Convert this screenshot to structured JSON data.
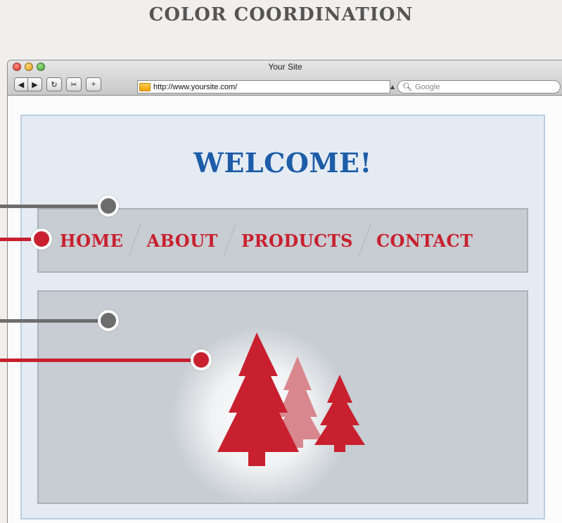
{
  "infographic": {
    "title": "COLOR COORDINATION"
  },
  "browser": {
    "window_title": "Your Site",
    "url": "http://www.yoursite.com/",
    "search_placeholder": "Google",
    "buttons": {
      "back": "◀",
      "forward": "▶",
      "reload": "↻",
      "snapback": "✂",
      "add_bookmark": "+"
    }
  },
  "site": {
    "heading": "WELCOME!",
    "nav": [
      "HOME",
      "ABOUT",
      "PRODUCTS",
      "CONTACT"
    ]
  },
  "colors": {
    "heading_blue": "#1d5ca8",
    "accent_red": "#c8202f",
    "callout_gray": "#6d6d6d",
    "panel_gray": "#c7cdd2",
    "page_blue": "#e4ebf2"
  },
  "icons": [
    "close-light-icon",
    "minimize-light-icon",
    "maximize-light-icon",
    "folder-icon",
    "magnifier-icon",
    "tree-icon"
  ]
}
